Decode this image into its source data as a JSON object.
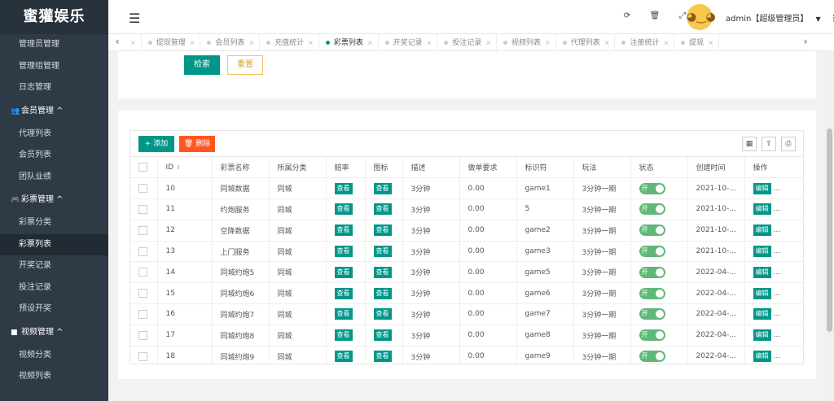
{
  "brand": "蜜獾娱乐",
  "sidebar": {
    "items": [
      {
        "type": "item",
        "label": "管理员管理"
      },
      {
        "type": "item",
        "label": "管理组管理"
      },
      {
        "type": "item",
        "label": "日志管理"
      },
      {
        "type": "group",
        "label": "会员管理 ^",
        "icon": "users-icon"
      },
      {
        "type": "item",
        "label": "代理列表"
      },
      {
        "type": "item",
        "label": "会员列表"
      },
      {
        "type": "item",
        "label": "团队业绩"
      },
      {
        "type": "group",
        "label": "彩票管理 ^",
        "icon": "gamepad-icon"
      },
      {
        "type": "item",
        "label": "彩票分类"
      },
      {
        "type": "item",
        "label": "彩票列表",
        "active": true
      },
      {
        "type": "item",
        "label": "开奖记录"
      },
      {
        "type": "item",
        "label": "投注记录"
      },
      {
        "type": "item",
        "label": "预设开奖"
      },
      {
        "type": "group",
        "label": "视频管理 ^",
        "icon": "video-icon"
      },
      {
        "type": "item",
        "label": "视频分类"
      },
      {
        "type": "item",
        "label": "视频列表"
      }
    ]
  },
  "topbar": {
    "fold_icon": "menu-fold-icon",
    "icons": [
      "refresh-icon",
      "trash-icon",
      "fullscreen-icon"
    ],
    "user_label": "admin【超级管理员】",
    "caret": "▼",
    "more": "⋮"
  },
  "tabs": {
    "prev": "‹",
    "next": "›",
    "items": [
      {
        "label": "",
        "active": false
      },
      {
        "label": "提现管理",
        "active": false
      },
      {
        "label": "会员列表",
        "active": false
      },
      {
        "label": "充值统计",
        "active": false
      },
      {
        "label": "彩票列表",
        "active": true
      },
      {
        "label": "开奖记录",
        "active": false
      },
      {
        "label": "投注记录",
        "active": false
      },
      {
        "label": "视频列表",
        "active": false
      },
      {
        "label": "代理列表",
        "active": false
      },
      {
        "label": "注册统计",
        "active": false
      },
      {
        "label": "提现",
        "active": false
      }
    ]
  },
  "search": {
    "search_label": "检索",
    "reset_label": "重置"
  },
  "toolbar": {
    "add_label": "添加",
    "delete_label": "删除"
  },
  "table": {
    "headers": [
      "",
      "ID",
      "彩票名称",
      "所属分类",
      "赔率",
      "图标",
      "描述",
      "做单要求",
      "标识符",
      "玩法",
      "状态",
      "创建时间",
      "操作"
    ],
    "view_label": "查看",
    "switch_label": "开",
    "edit_label": "编辑",
    "rows": [
      {
        "id": "10",
        "name": "同城数据",
        "category": "同城",
        "desc": "3分钟",
        "req": "0.00",
        "key": "game1",
        "play": "3分钟一期",
        "created": "2021-10-..."
      },
      {
        "id": "11",
        "name": "约炮服务",
        "category": "同城",
        "desc": "3分钟",
        "req": "0.00",
        "key": "5",
        "play": "3分钟一期",
        "created": "2021-10-..."
      },
      {
        "id": "12",
        "name": "空降数据",
        "category": "同城",
        "desc": "3分钟",
        "req": "0.00",
        "key": "game2",
        "play": "3分钟一期",
        "created": "2021-10-..."
      },
      {
        "id": "13",
        "name": "上门服务",
        "category": "同城",
        "desc": "3分钟",
        "req": "0.00",
        "key": "game3",
        "play": "3分钟一期",
        "created": "2021-10-..."
      },
      {
        "id": "14",
        "name": "同城约炮5",
        "category": "同城",
        "desc": "3分钟",
        "req": "0.00",
        "key": "game5",
        "play": "3分钟一期",
        "created": "2022-04-..."
      },
      {
        "id": "15",
        "name": "同城约炮6",
        "category": "同城",
        "desc": "3分钟",
        "req": "0.00",
        "key": "game6",
        "play": "3分钟一期",
        "created": "2022-04-..."
      },
      {
        "id": "16",
        "name": "同城约炮7",
        "category": "同城",
        "desc": "3分钟",
        "req": "0.00",
        "key": "game7",
        "play": "3分钟一期",
        "created": "2022-04-..."
      },
      {
        "id": "17",
        "name": "同城约炮8",
        "category": "同城",
        "desc": "3分钟",
        "req": "0.00",
        "key": "game8",
        "play": "3分钟一期",
        "created": "2022-04-..."
      },
      {
        "id": "18",
        "name": "同城约炮9",
        "category": "同城",
        "desc": "3分钟",
        "req": "0.00",
        "key": "game9",
        "play": "3分钟一期",
        "created": "2022-04-..."
      }
    ]
  },
  "colors": {
    "primary": "#009688",
    "danger": "#ff5722",
    "switch_on": "#5fb878",
    "sidebar_bg": "#2f3a47"
  }
}
